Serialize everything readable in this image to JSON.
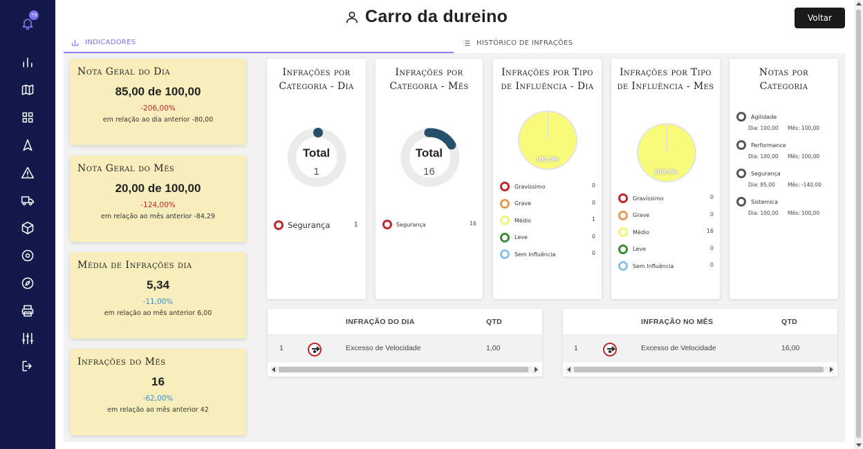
{
  "sidebar": {
    "notification_count": "79",
    "icons": [
      "bell-icon",
      "bar-chart-icon",
      "map-icon",
      "dashboard-grid-icon",
      "navigation-arrow-icon",
      "warning-triangle-icon",
      "truck-icon",
      "package-icon",
      "target-icon",
      "compass-icon",
      "printer-icon",
      "sliders-icon",
      "logout-icon"
    ]
  },
  "header": {
    "title": "Carro da dureino",
    "back_label": "Voltar"
  },
  "tabs": [
    {
      "label": "INDICADORES",
      "active": true
    },
    {
      "label": "HISTÓRICO DE INFRAÇÕES",
      "active": false
    }
  ],
  "kpis": [
    {
      "title": "Nota Geral do Dia",
      "value": "85,00 de 100,00",
      "pct": "-206,00%",
      "note": "em relação ao dia anterior -80,00"
    },
    {
      "title": "Nota Geral do Mês",
      "value": "20,00 de 100,00",
      "pct": "-124,00%",
      "note": "em relação ao mês anterior -84,29"
    },
    {
      "title": "Média de Infrações dia",
      "value": "5,34",
      "pct": "-11,00%",
      "note": "em relação ao mês anterior 6,00"
    },
    {
      "title": "Infrações do Mês",
      "value": "16",
      "pct": "-62,00%",
      "note": "em relação ao mês anterior 42"
    }
  ],
  "colors": {
    "sidebar": "#111a4a",
    "accent": "#7b6cf0",
    "kpi_bg": "#f7eebc",
    "negative": "#c0272d",
    "negative_blue": "#3b8fd6",
    "donut_fill": "#26506a",
    "donut_track": "#ebebeb",
    "pie_yellow": "#f8fb7a"
  },
  "category_day": {
    "title": "Infrações por Categoria - Dia",
    "center_label": "Total",
    "total": "1",
    "legend": [
      {
        "label": "Segurança",
        "value": "1",
        "color": "#c0272d"
      }
    ]
  },
  "category_month": {
    "title": "Infrações por Categoria - Mês",
    "center_label": "Total",
    "total": "16",
    "legend": [
      {
        "label": "Segurança",
        "value": "16",
        "color": "#c0272d"
      }
    ]
  },
  "influence_day": {
    "title": "Infrações por Tipo de Influência - Dia",
    "pie_label": "100.0%",
    "legend": [
      {
        "label": "Gravíssimo",
        "value": "0",
        "color": "#c0272d"
      },
      {
        "label": "Grave",
        "value": "0",
        "color": "#e89a55"
      },
      {
        "label": "Médio",
        "value": "1",
        "color": "#f3f47a"
      },
      {
        "label": "Leve",
        "value": "0",
        "color": "#3a8a3a"
      },
      {
        "label": "Sem Influência",
        "value": "0",
        "color": "#8cbfe6"
      }
    ]
  },
  "influence_month": {
    "title": "Infrações por Tipo de Influência - Mes",
    "pie_label": "100.0%",
    "legend": [
      {
        "label": "Gravíssimo",
        "value": "0",
        "color": "#c0272d"
      },
      {
        "label": "Grave",
        "value": "0",
        "color": "#e89a55"
      },
      {
        "label": "Médio",
        "value": "16",
        "color": "#f3f47a"
      },
      {
        "label": "Leve",
        "value": "0",
        "color": "#3a8a3a"
      },
      {
        "label": "Sem Influência",
        "value": "0",
        "color": "#8cbfe6"
      }
    ]
  },
  "notes_category": {
    "title": "Notas por Categoria",
    "items": [
      {
        "label": "Agilidade",
        "day": "Dia: 100,00",
        "month": "Mês: 100,00"
      },
      {
        "label": "Performance",
        "day": "Dia: 100,00",
        "month": "Mês: 100,00"
      },
      {
        "label": "Segurança",
        "day": "Dia: 85,00",
        "month": "Mês: -140,00"
      },
      {
        "label": "Sistemica",
        "day": "Dia: 100,00",
        "month": "Mês: 100,00"
      }
    ]
  },
  "table_day": {
    "headers": [
      "INFRAÇÃO DO DIA",
      "QTD"
    ],
    "rows": [
      {
        "index": "1",
        "icon": "speeding-icon",
        "name": "Excesso de Velocidade",
        "qty": "1,00"
      }
    ]
  },
  "table_month": {
    "headers": [
      "INFRAÇÃO NO MÊS",
      "QTD"
    ],
    "rows": [
      {
        "index": "1",
        "icon": "speeding-icon",
        "name": "Excesso de Velocidade",
        "qty": "16,00"
      }
    ]
  },
  "chart_data": [
    {
      "type": "pie",
      "title": "Infrações por Categoria - Dia",
      "categories": [
        "Segurança"
      ],
      "values": [
        1
      ],
      "total": 1
    },
    {
      "type": "pie",
      "title": "Infrações por Categoria - Mês",
      "categories": [
        "Segurança"
      ],
      "values": [
        16
      ],
      "total": 16
    },
    {
      "type": "pie",
      "title": "Infrações por Tipo de Influência - Dia",
      "categories": [
        "Gravíssimo",
        "Grave",
        "Médio",
        "Leve",
        "Sem Influência"
      ],
      "values": [
        0,
        0,
        1,
        0,
        0
      ]
    },
    {
      "type": "pie",
      "title": "Infrações por Tipo de Influência - Mes",
      "categories": [
        "Gravíssimo",
        "Grave",
        "Médio",
        "Leve",
        "Sem Influência"
      ],
      "values": [
        0,
        0,
        16,
        0,
        0
      ]
    }
  ]
}
